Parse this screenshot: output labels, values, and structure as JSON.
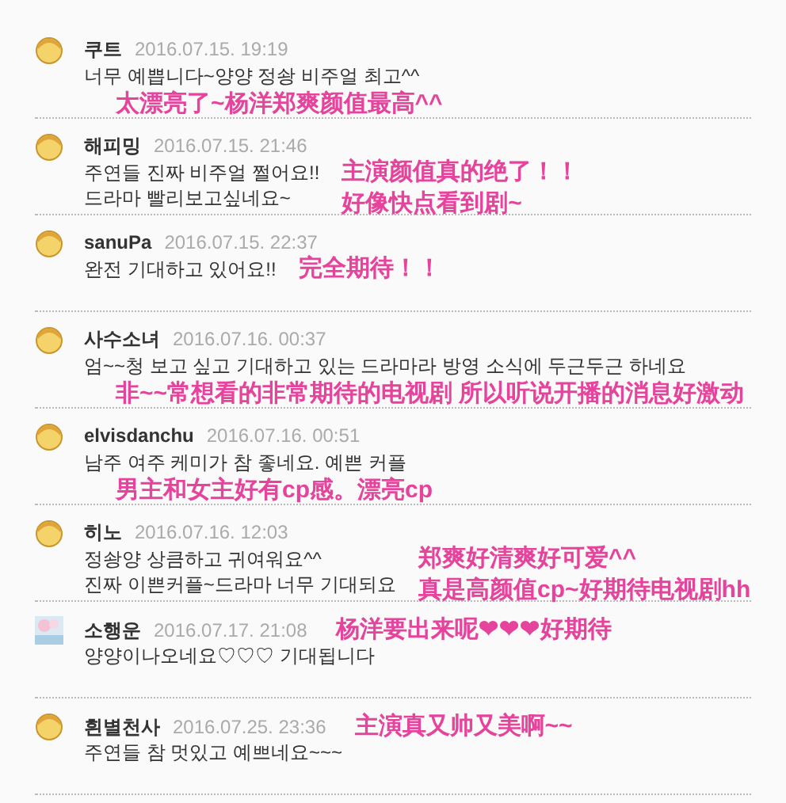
{
  "comments": [
    {
      "user": "쿠트",
      "date": "2016.07.15. 19:19",
      "avatar": {
        "kind": "smiley"
      },
      "lines": [
        "너무 예쁩니다~양양 정솽 비주얼 최고^^"
      ],
      "kind": "below",
      "notes": [
        "太漂亮了~杨洋郑爽颜值最高^^"
      ]
    },
    {
      "user": "해피밍",
      "date": "2016.07.15. 21:46",
      "avatar": {
        "kind": "smiley"
      },
      "lines": [
        "주연들 진짜 비주얼 쩔어요!!",
        "드라마 빨리보고싶네요~"
      ],
      "kind": "right",
      "notes": [
        "主演颜值真的绝了！！",
        "好像快点看到剧~"
      ]
    },
    {
      "user": "sanuPa",
      "date": "2016.07.15. 22:37",
      "avatar": {
        "kind": "smiley"
      },
      "lines": [
        "완전 기대하고 있어요!!"
      ],
      "kind": "right",
      "notes": [
        "完全期待！！"
      ]
    },
    {
      "user": "사수소녀",
      "date": "2016.07.16. 00:37",
      "avatar": {
        "kind": "smiley"
      },
      "lines": [
        "엄~~청 보고 싶고 기대하고 있는 드라마라 방영 소식에 두근두근 하네요"
      ],
      "kind": "below",
      "notes": [
        "非~~常想看的非常期待的电视剧 所以听说开播的消息好激动"
      ]
    },
    {
      "user": "elvisdanchu",
      "date": "2016.07.16. 00:51",
      "avatar": {
        "kind": "smiley"
      },
      "lines": [
        "남주 여주 케미가 참 좋네요. 예쁜 커플"
      ],
      "kind": "below",
      "notes": [
        "男主和女主好有cp感。漂亮cp"
      ]
    },
    {
      "user": "히노",
      "date": "2016.07.16. 12:03",
      "avatar": {
        "kind": "smiley"
      },
      "lines": [
        "정솽양 상큼하고 귀여워요^^",
        "진짜 이쁜커플~드라마 너무 기대되요"
      ],
      "kind": "right",
      "notes": [
        "郑爽好清爽好可爱^^",
        "真是高颜值cp~好期待电视剧hh"
      ]
    },
    {
      "user": "소행운",
      "date": "2016.07.17. 21:08",
      "avatar": {
        "kind": "picture"
      },
      "lines": [
        "양양이나오네요♡♡♡ 기대됩니다"
      ],
      "kind": "header",
      "notes": [
        "杨洋要出来呢❤❤❤好期待"
      ]
    },
    {
      "user": "흰별천사",
      "date": "2016.07.25. 23:36",
      "avatar": {
        "kind": "smiley"
      },
      "lines": [
        "주연들 참 멋있고 예쁘네요~~~"
      ],
      "kind": "header",
      "notes": [
        "主演真又帅又美啊~~"
      ]
    }
  ]
}
